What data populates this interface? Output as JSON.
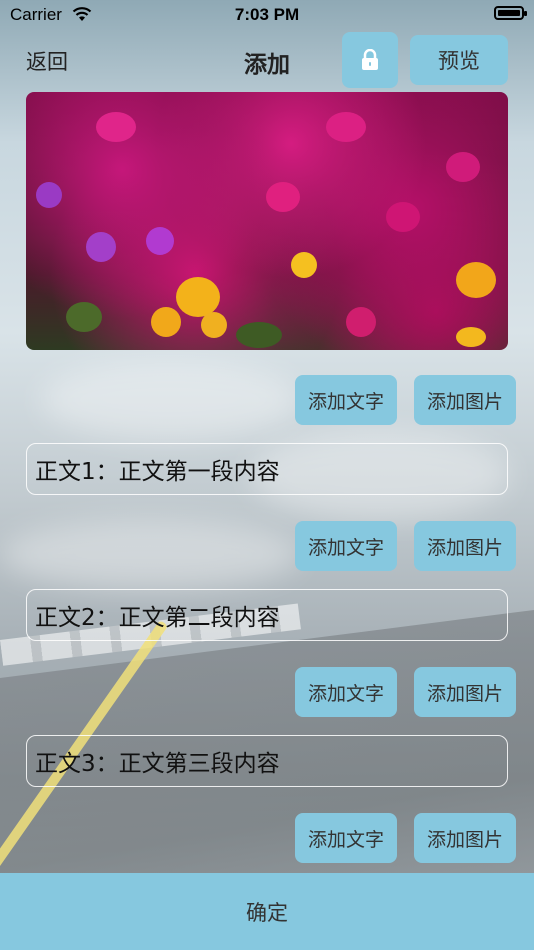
{
  "status": {
    "carrier": "Carrier",
    "time": "7:03 PM"
  },
  "nav": {
    "back": "返回",
    "title": "添加",
    "preview": "预览"
  },
  "icons": {
    "lock": "lock-icon",
    "wifi": "wifi-icon",
    "battery": "battery-icon"
  },
  "colors": {
    "accent": "#86c8df"
  },
  "actions": {
    "add_text": "添加文字",
    "add_image": "添加图片"
  },
  "paragraphs": [
    {
      "text": "正文1：正文第一段内容"
    },
    {
      "text": "正文2：正文第二段内容"
    },
    {
      "text": "正文3：正文第三段内容"
    }
  ],
  "confirm": "确定"
}
